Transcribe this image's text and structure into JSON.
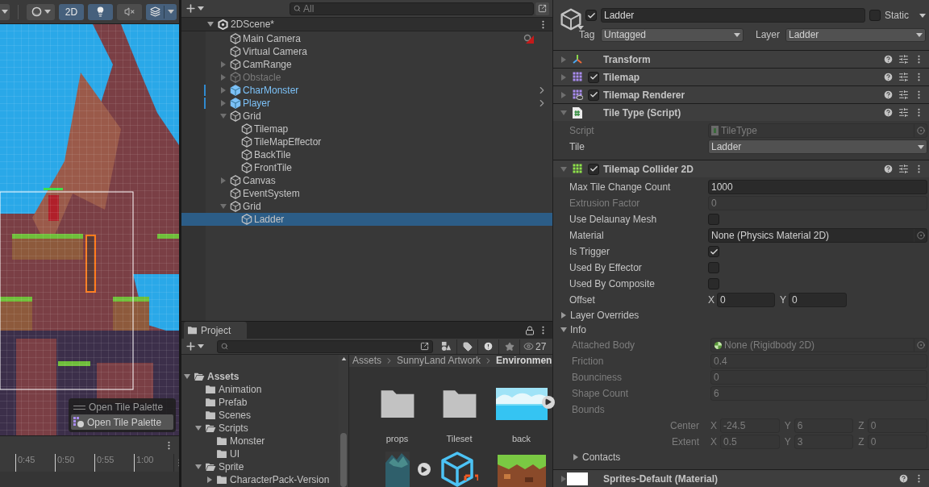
{
  "scene_view": {
    "toolbar": [
      {
        "kind": "shading",
        "selected": false
      },
      {
        "kind": "mode",
        "label": "2D",
        "selected": true
      },
      {
        "kind": "lighting",
        "selected": true
      },
      {
        "kind": "audio",
        "selected": false
      },
      {
        "kind": "effects",
        "selected": true
      }
    ],
    "overlay": {
      "title": "Open Tile Palette",
      "button": "Open Tile Palette"
    }
  },
  "timeline": {
    "ticks": [
      "0:45",
      "0:50",
      "0:55",
      "1:00"
    ]
  },
  "hierarchy": {
    "search": {
      "placeholder": "All"
    },
    "scene": "2DScene*",
    "items": [
      {
        "name": "Main Camera",
        "prefab": false,
        "inactive": false,
        "selected": false,
        "gizmo": true
      },
      {
        "name": "Virtual Camera",
        "prefab": false,
        "inactive": false,
        "selected": false,
        "gizmo": false
      },
      {
        "name": "CamRange",
        "expanded": false,
        "prefab": false,
        "inactive": false,
        "selected": false,
        "gizmo": false
      },
      {
        "name": "Obstacle",
        "expanded": false,
        "prefab": false,
        "inactive": true,
        "selected": false,
        "gizmo": false
      },
      {
        "name": "CharMonster",
        "expanded": false,
        "prefab": true,
        "inactive": false,
        "selected": false,
        "gizmo": false
      },
      {
        "name": "Player",
        "expanded": false,
        "prefab": true,
        "inactive": false,
        "selected": false,
        "gizmo": false
      },
      {
        "name": "Grid",
        "expanded": true,
        "prefab": false,
        "inactive": false,
        "selected": false,
        "gizmo": false,
        "children": [
          {
            "name": "Tilemap",
            "prefab": false,
            "inactive": false,
            "selected": false,
            "gizmo": false
          },
          {
            "name": "TileMapEffector",
            "prefab": false,
            "inactive": false,
            "selected": false,
            "gizmo": false
          },
          {
            "name": "BackTile",
            "prefab": false,
            "inactive": false,
            "selected": false,
            "gizmo": false
          },
          {
            "name": "FrontTile",
            "prefab": false,
            "inactive": false,
            "selected": false,
            "gizmo": false
          }
        ]
      },
      {
        "name": "Canvas",
        "expanded": false,
        "prefab": false,
        "inactive": false,
        "selected": false,
        "gizmo": false
      },
      {
        "name": "EventSystem",
        "prefab": false,
        "inactive": false,
        "selected": false,
        "gizmo": false
      },
      {
        "name": "Grid",
        "expanded": true,
        "prefab": false,
        "inactive": false,
        "selected": false,
        "gizmo": false,
        "children": [
          {
            "name": "Ladder",
            "prefab": false,
            "inactive": false,
            "selected": true,
            "gizmo": false
          }
        ]
      }
    ]
  },
  "project": {
    "tab": "Project",
    "count": "27",
    "folders": [
      {
        "name": "Assets",
        "expanded": true,
        "children": [
          {
            "name": "Animation"
          },
          {
            "name": "Prefab"
          },
          {
            "name": "Scenes"
          },
          {
            "name": "Scripts",
            "expanded": true,
            "children": [
              {
                "name": "Monster"
              },
              {
                "name": "UI"
              }
            ]
          },
          {
            "name": "Sprite",
            "expanded": true,
            "children": [
              {
                "name": "CharacterPack-Version",
                "expanded": false
              }
            ]
          }
        ]
      }
    ],
    "breadcrumb": [
      "Assets",
      "SunnyLand Artwork",
      "Environmen"
    ],
    "assets": [
      {
        "kind": "folder",
        "name": "props",
        "animated": false
      },
      {
        "kind": "folder",
        "name": "Tileset",
        "animated": false
      },
      {
        "kind": "sky",
        "name": "back",
        "animated": true
      },
      {
        "kind": "rocks",
        "animated": true
      },
      {
        "kind": "prefab",
        "animated": false
      },
      {
        "kind": "grass",
        "animated": false
      }
    ]
  },
  "inspector": {
    "object": {
      "active": true,
      "name": "Ladder",
      "static": false,
      "static_label": "Static",
      "tag_label": "Tag",
      "tag": "Untagged",
      "layer_label": "Layer",
      "layer": "Ladder"
    },
    "components": [
      {
        "kind": "transform",
        "name": "Transform",
        "expanded": false
      },
      {
        "kind": "tilemap",
        "name": "Tilemap",
        "enabled": true,
        "expanded": false
      },
      {
        "kind": "renderer",
        "name": "Tilemap Renderer",
        "enabled": true,
        "expanded": false
      },
      {
        "kind": "script",
        "name": "Tile Type (Script)",
        "expanded": true,
        "properties": [
          {
            "kind": "object",
            "label": "Script",
            "value": "TileType",
            "disabled": true
          },
          {
            "kind": "dropdown",
            "label": "Tile",
            "value": "Ladder",
            "disabled": false
          }
        ]
      },
      {
        "kind": "collider",
        "name": "Tilemap Collider 2D",
        "enabled": true,
        "expanded": true,
        "properties": [
          {
            "kind": "field",
            "label": "Max Tile Change Count",
            "value": "1000",
            "disabled": false
          },
          {
            "kind": "field",
            "label": "Extrusion Factor",
            "value": "0",
            "disabled": true
          },
          {
            "kind": "checkbox",
            "label": "Use Delaunay Mesh",
            "checked": false
          },
          {
            "kind": "object",
            "label": "Material",
            "value": "None (Physics Material 2D)",
            "disabled": false
          },
          {
            "kind": "checkbox",
            "label": "Is Trigger",
            "checked": true
          },
          {
            "kind": "checkbox",
            "label": "Used By Effector",
            "checked": false
          },
          {
            "kind": "checkbox",
            "label": "Used By Composite",
            "checked": false
          },
          {
            "kind": "vector2",
            "label": "Offset",
            "axes": [
              {
                "axis": "X",
                "value": "0"
              },
              {
                "axis": "Y",
                "value": "0"
              }
            ]
          },
          {
            "kind": "foldout",
            "label": "Layer Overrides",
            "expanded": false
          },
          {
            "kind": "foldout",
            "label": "Info",
            "expanded": true,
            "children": [
              {
                "kind": "body",
                "label": "Attached Body",
                "value": "None (Rigidbody 2D)",
                "disabled": true
              },
              {
                "kind": "field",
                "label": "Friction",
                "value": "0.4",
                "disabled": true
              },
              {
                "kind": "field",
                "label": "Bounciness",
                "value": "0",
                "disabled": true
              },
              {
                "kind": "field",
                "label": "Shape Count",
                "value": "6",
                "disabled": true
              },
              {
                "kind": "label",
                "label": "Bounds"
              },
              {
                "kind": "vector3",
                "label": "Center",
                "axes": [
                  {
                    "axis": "X",
                    "value": "-24.5"
                  },
                  {
                    "axis": "Y",
                    "value": "6"
                  },
                  {
                    "axis": "Z",
                    "value": "0"
                  }
                ]
              },
              {
                "kind": "vector3",
                "label": "Extent",
                "axes": [
                  {
                    "axis": "X",
                    "value": "0.5"
                  },
                  {
                    "axis": "Y",
                    "value": "3"
                  },
                  {
                    "axis": "Z",
                    "value": "0"
                  }
                ]
              },
              {
                "kind": "foldout",
                "label": "Contacts",
                "expanded": false
              }
            ]
          }
        ]
      },
      {
        "kind": "material",
        "name": "Sprites-Default (Material)",
        "expanded": false
      }
    ]
  }
}
